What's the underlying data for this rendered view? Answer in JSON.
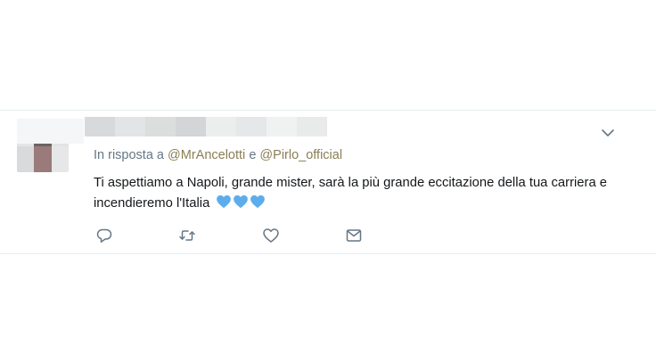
{
  "tweet": {
    "reply_prefix": "In risposta a",
    "mention_1": "@MrAncelotti",
    "conjunction": "e",
    "mention_2": "@Pirlo_official",
    "body_text": "Ti aspettiamo a Napoli, grande mister, sarà la più grande eccitazione della tua carriera e incendieremo l'Italia",
    "emoji_icons": [
      "blue-heart-icon",
      "blue-heart-icon",
      "blue-heart-icon"
    ]
  },
  "actions": {
    "reply_icon": "speech-bubble-icon",
    "retweet_icon": "retweet-icon",
    "like_icon": "heart-icon",
    "dm_icon": "envelope-icon",
    "menu_icon": "chevron-down-icon"
  },
  "colors": {
    "accent_heart": "#5dadec",
    "muted": "#657786",
    "mention": "#8b7e55",
    "icon": "#657786",
    "divider": "#e6ecf0"
  }
}
